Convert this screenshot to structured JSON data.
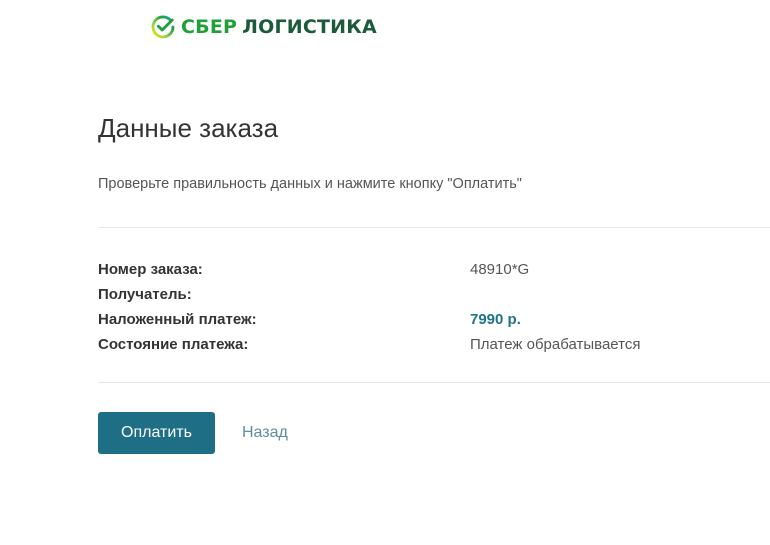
{
  "brand": {
    "logo_icon": "sber-check-circle-icon",
    "name_part1": "СБЕР",
    "name_part2": "ЛОГИСТИКА",
    "colors": {
      "sber_green": "#21a038",
      "dark_green": "#1b5b3a"
    }
  },
  "page": {
    "title": "Данные заказа",
    "subtitle": "Проверьте правильность данных и нажмите кнопку \"Оплатить\""
  },
  "order": {
    "rows": [
      {
        "label": "Номер заказа:",
        "value": "48910*G"
      },
      {
        "label": "Получатель:",
        "value": ""
      },
      {
        "label": "Наложенный платеж:",
        "value": "7990 р."
      },
      {
        "label": "Состояние платежа:",
        "value": "Платеж обрабатывается"
      }
    ]
  },
  "actions": {
    "pay_label": "Оплатить",
    "back_label": "Назад",
    "accent_color": "#1e6e86"
  }
}
